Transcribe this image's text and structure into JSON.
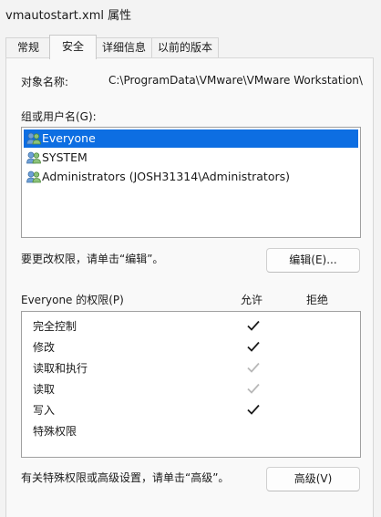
{
  "window": {
    "title": "vmautostart.xml 属性"
  },
  "tabs": [
    {
      "label": "常规",
      "active": false
    },
    {
      "label": "安全",
      "active": true
    },
    {
      "label": "详细信息",
      "active": false
    },
    {
      "label": "以前的版本",
      "active": false
    }
  ],
  "security": {
    "object_name_label": "对象名称:",
    "object_name_value": "C:\\ProgramData\\VMware\\VMware Workstation\\",
    "groups_label": "组或用户名(G):",
    "users": [
      {
        "name": "Everyone",
        "icon": "users-group-icon",
        "selected": true
      },
      {
        "name": "SYSTEM",
        "icon": "users-group-icon",
        "selected": false
      },
      {
        "name": "Administrators (JOSH31314\\Administrators)",
        "icon": "users-group-icon",
        "selected": false
      }
    ],
    "change_hint": "要更改权限，请单击“编辑”。",
    "edit_button": "编辑(E)...",
    "permissions_label": "Everyone 的权限(P)",
    "allow_header": "允许",
    "deny_header": "拒绝",
    "permissions": [
      {
        "name": "完全控制",
        "allow": "checked"
      },
      {
        "name": "修改",
        "allow": "checked"
      },
      {
        "name": "读取和执行",
        "allow": "checked-disabled"
      },
      {
        "name": "读取",
        "allow": "checked-disabled"
      },
      {
        "name": "写入",
        "allow": "checked"
      },
      {
        "name": "特殊权限",
        "allow": "none"
      }
    ],
    "advanced_hint": "有关特殊权限或高级设置，请单击“高级”。",
    "advanced_button": "高级(V)"
  },
  "colors": {
    "selection": "#0d6ee2",
    "check_enabled": "#1a1a1a",
    "check_disabled": "#b8b8b8"
  }
}
